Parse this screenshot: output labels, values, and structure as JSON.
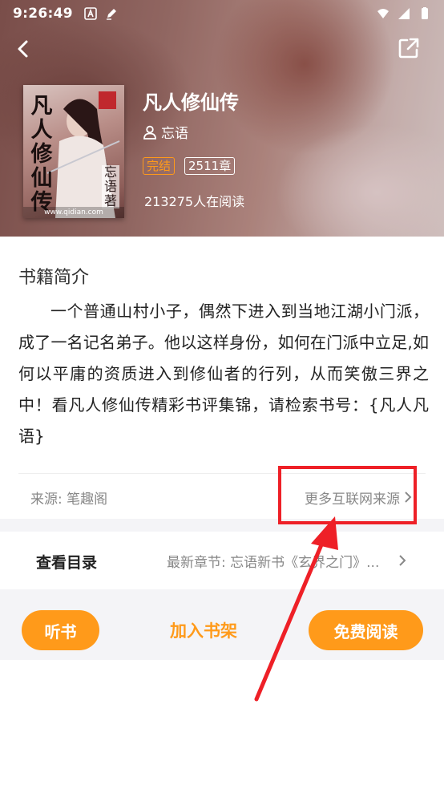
{
  "status_bar": {
    "time": "9:26:49"
  },
  "book": {
    "title": "凡人修仙传",
    "author": "忘语",
    "status_tag": "完结",
    "chapters_tag": "2511章",
    "readers": "213275人在阅读",
    "cover": {
      "title_chars": [
        "凡",
        "人",
        "修",
        "仙",
        "传"
      ],
      "author_text": "忘语著",
      "url_text": "www.qidian.com"
    }
  },
  "synopsis": {
    "heading": "书籍简介",
    "text": "一个普通山村小子，偶然下进入到当地江湖小门派，成了一名记名弟子。他以这样身份，如何在门派中立足,如何以平庸的资质进入到修仙者的行列，从而笑傲三界之中！看凡人修仙传精彩书评集锦，请检索书号：{凡人凡语}",
    "source": "来源: 笔趣阁",
    "more_sources": "更多互联网来源"
  },
  "catalog": {
    "label": "查看目录",
    "latest": "最新章节: 忘语新书《玄界之门》..."
  },
  "actions": {
    "listen": "听书",
    "add_shelf": "加入书架",
    "free_read": "免费阅读"
  },
  "colors": {
    "accent": "#ff9a1a",
    "annotation": "#ee2027",
    "band": "#f4f4f7"
  },
  "icons": {
    "back": "back-arrow-icon",
    "share": "share-icon",
    "author": "person-icon",
    "chevron": "chevron-right-icon"
  }
}
